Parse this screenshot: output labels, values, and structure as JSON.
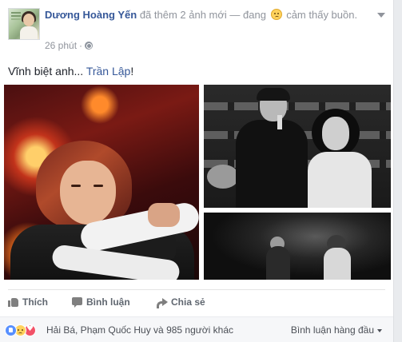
{
  "post": {
    "author": "Dương Hoàng Yến",
    "action_text": "đã thêm 2 ảnh mới — đang",
    "feeling_text": "cảm thấy buồn.",
    "time": "26 phút",
    "status_prefix": "Vĩnh biệt anh...",
    "status_tag": "Trần Lập",
    "status_suffix": "!"
  },
  "actions": {
    "like": "Thích",
    "comment": "Bình luận",
    "share": "Chia sẻ"
  },
  "reactions": {
    "names": "Hải Bá, Phạm Quốc Huy và 985 người khác",
    "sort_label": "Bình luận hàng đầu"
  }
}
